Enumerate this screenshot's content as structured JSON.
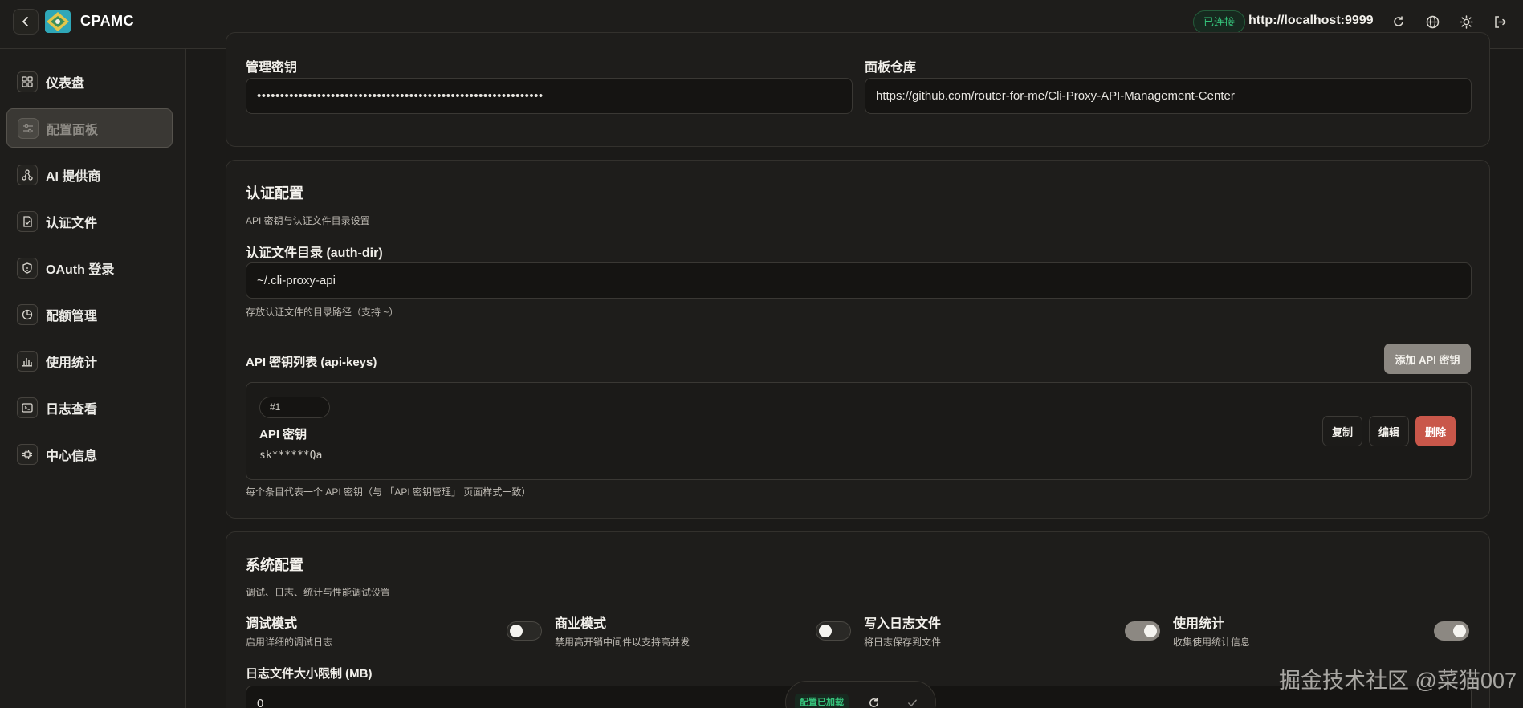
{
  "app": {
    "brand": "CPAMC",
    "connection_status": "已连接",
    "server_url": "http://localhost:9999"
  },
  "topbar_icons": [
    "refresh-icon",
    "globe-icon",
    "sun-icon",
    "logout-icon"
  ],
  "sidebar": {
    "items": [
      {
        "label": "仪表盘",
        "icon": "dashboard-icon"
      },
      {
        "label": "配置面板",
        "icon": "sliders-icon",
        "active": true
      },
      {
        "label": "AI 提供商",
        "icon": "network-icon"
      },
      {
        "label": "认证文件",
        "icon": "file-check-icon"
      },
      {
        "label": "OAuth 登录",
        "icon": "shield-icon"
      },
      {
        "label": "配额管理",
        "icon": "pie-chart-icon"
      },
      {
        "label": "使用统计",
        "icon": "bar-chart-icon"
      },
      {
        "label": "日志查看",
        "icon": "terminal-icon"
      },
      {
        "label": "中心信息",
        "icon": "chip-icon"
      }
    ]
  },
  "top_card": {
    "mgmt_key_label": "管理密钥",
    "mgmt_key_value": "••••••••••••••••••••••••••••••••••••••••••••••••••••••••••••••",
    "repo_label": "面板仓库",
    "repo_value": "https://github.com/router-for-me/Cli-Proxy-API-Management-Center"
  },
  "auth_card": {
    "title": "认证配置",
    "desc": "API 密钥与认证文件目录设置",
    "dir_label": "认证文件目录 (auth-dir)",
    "dir_value": "~/.cli-proxy-api",
    "dir_hint": "存放认证文件的目录路径（支持 ~）",
    "keys_label": "API 密钥列表 (api-keys)",
    "add_key_button": "添加 API 密钥",
    "key_entry": {
      "index": "#1",
      "title": "API 密钥",
      "value": "sk******Qa",
      "copy": "复制",
      "edit": "编辑",
      "delete": "删除"
    },
    "keys_hint": "每个条目代表一个 API 密钥（与 「API 密钥管理」 页面样式一致）"
  },
  "system_card": {
    "title": "系统配置",
    "desc": "调试、日志、统计与性能调试设置",
    "switches": [
      {
        "title": "调试模式",
        "desc": "启用详细的调试日志",
        "on": false
      },
      {
        "title": "商业模式",
        "desc": "禁用高开销中间件以支持高并发",
        "on": false
      },
      {
        "title": "写入日志文件",
        "desc": "将日志保存到文件",
        "on": true
      },
      {
        "title": "使用统计",
        "desc": "收集使用统计信息",
        "on": true
      }
    ],
    "log_size_label": "日志文件大小限制 (MB)",
    "log_size_value": "0"
  },
  "floating_bar": {
    "status": "配置已加载"
  },
  "watermark": "掘金技术社区 @菜猫007",
  "colors": {
    "accent_green": "#35c27a",
    "danger": "#c9574a",
    "neutral_button": "#8c8882"
  }
}
